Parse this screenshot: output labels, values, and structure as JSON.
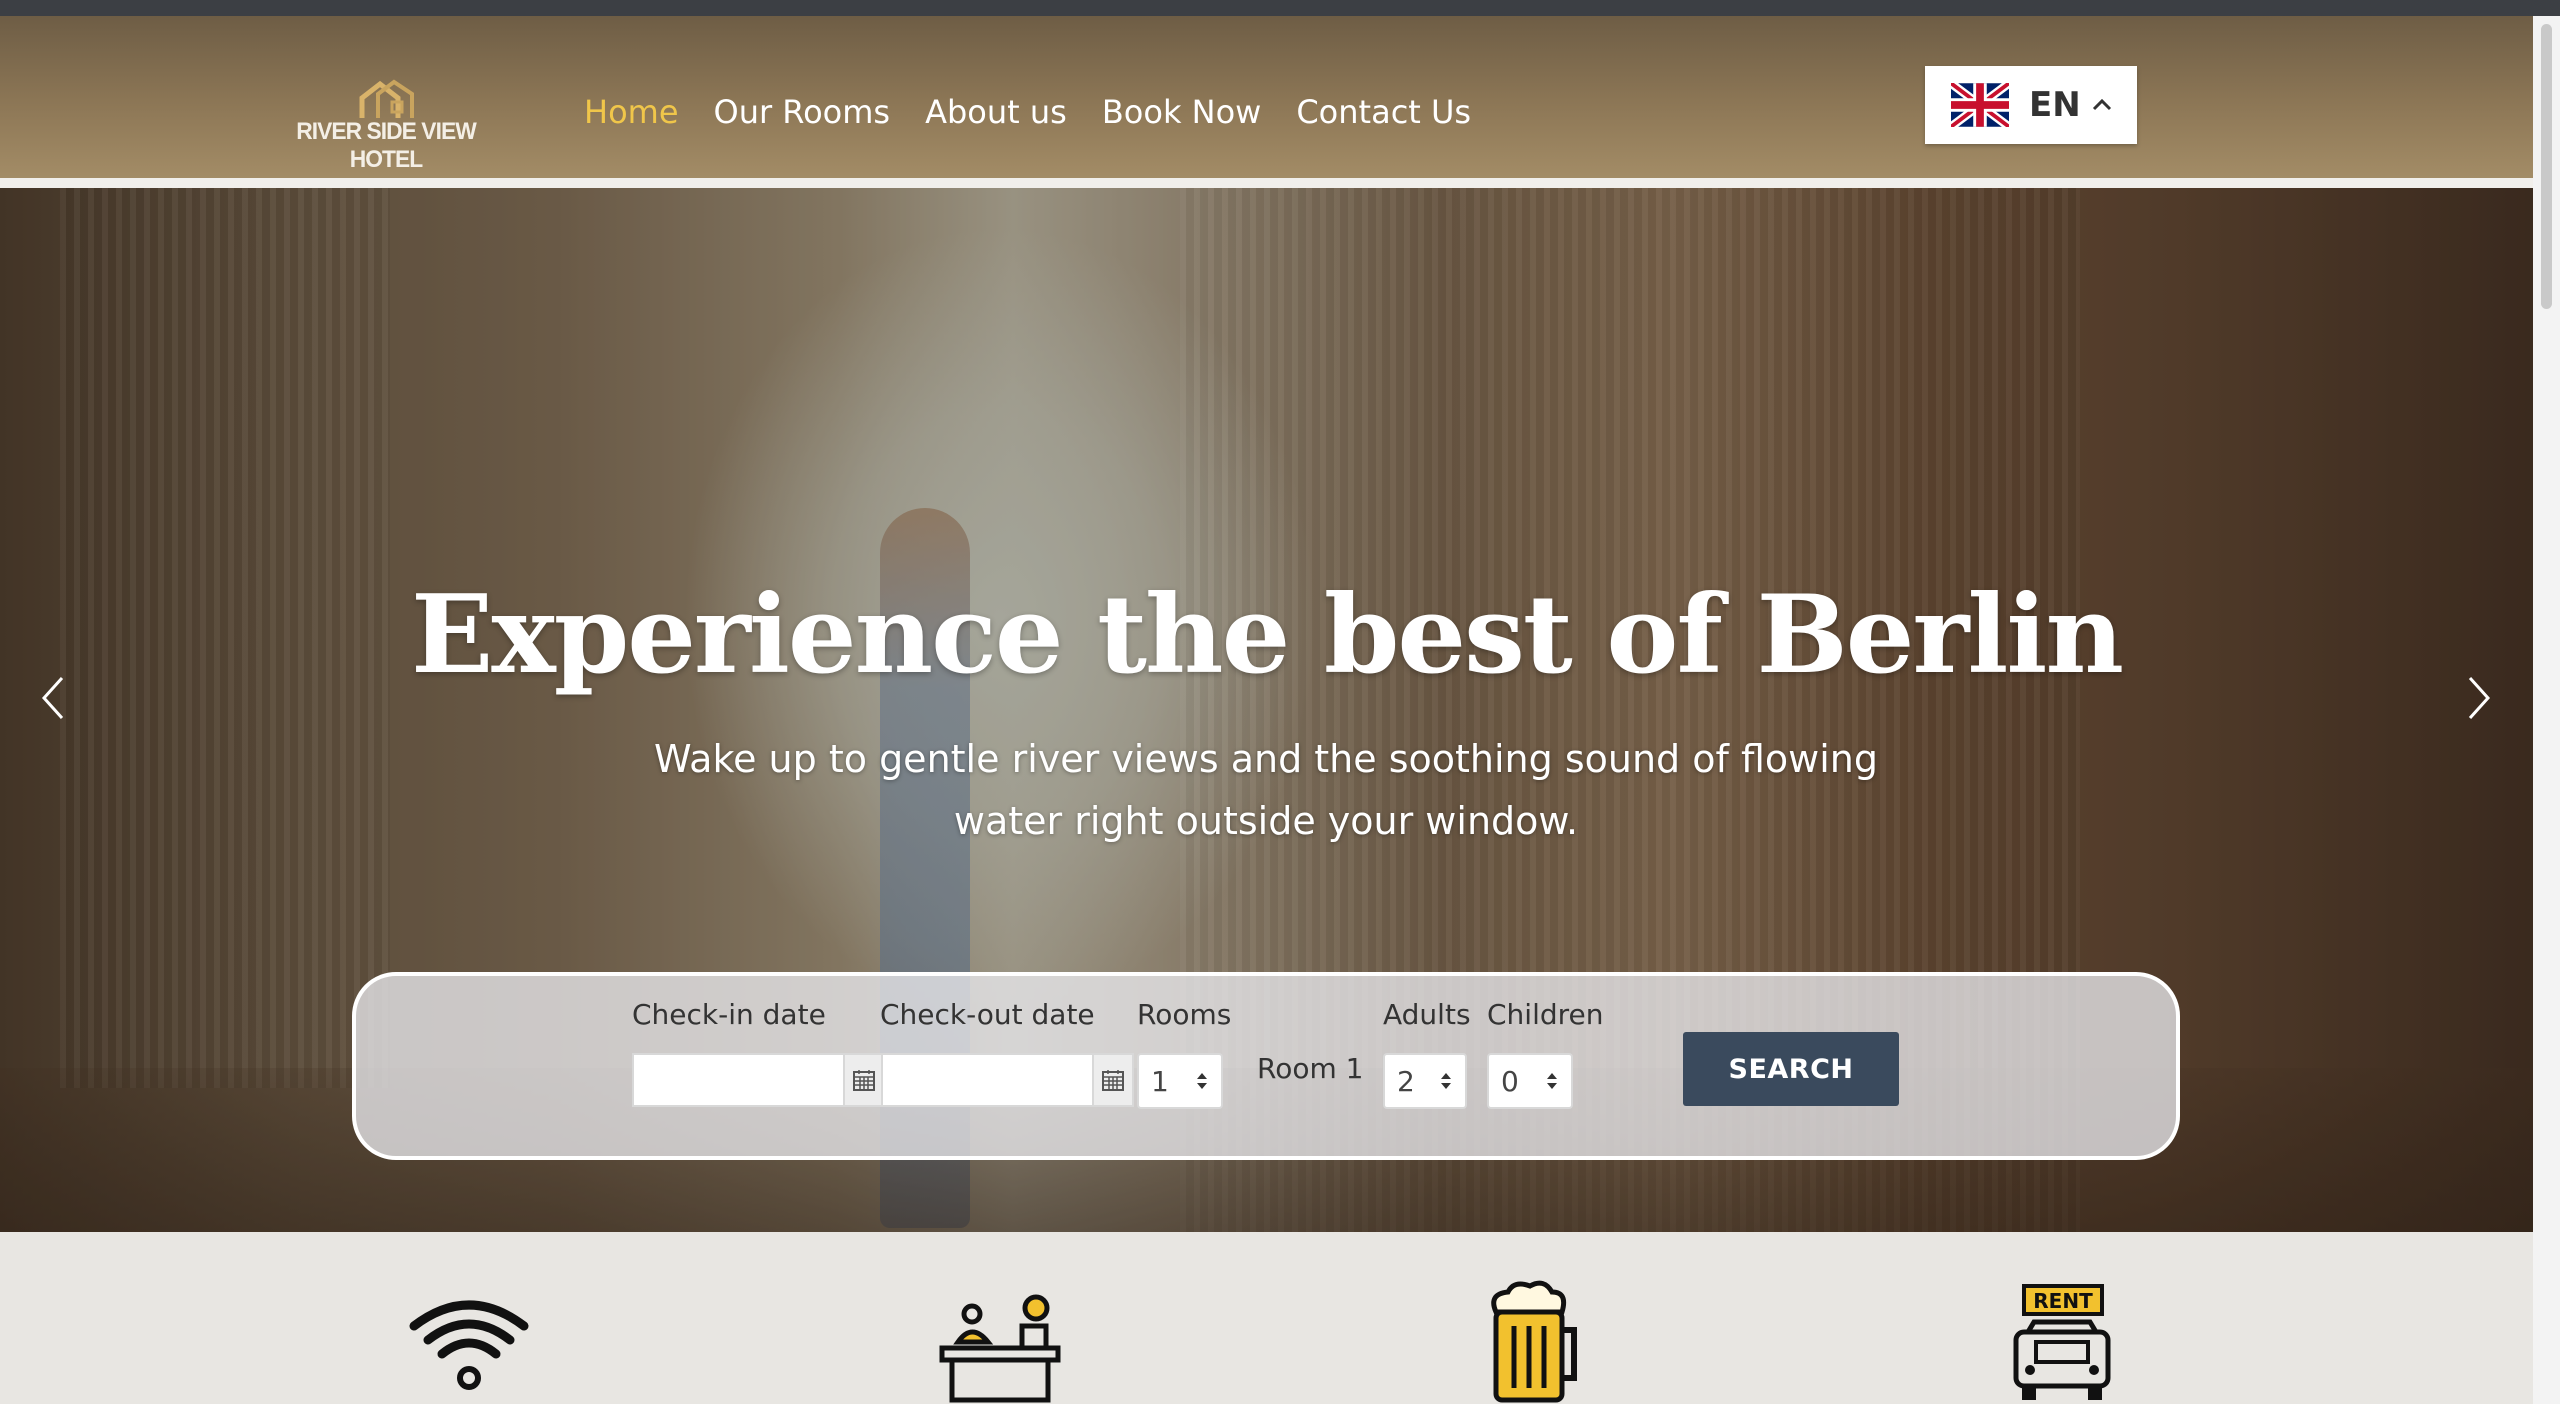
{
  "brand": {
    "logo_text": "RIVER SIDE VIEW HOTEL"
  },
  "nav": {
    "items": [
      {
        "label": "Home",
        "active": true
      },
      {
        "label": "Our Rooms",
        "active": false
      },
      {
        "label": "About us",
        "active": false
      },
      {
        "label": "Book Now",
        "active": false
      },
      {
        "label": "Contact Us",
        "active": false
      }
    ]
  },
  "language": {
    "code": "EN",
    "flag_icon": "uk-flag-icon",
    "chevron_icon": "chevron-up-icon"
  },
  "hero": {
    "title": "Experience the best of Berlin",
    "subtitle_line1": "Wake up to gentle river views and the soothing sound of flowing",
    "subtitle_line2": "water right outside your window."
  },
  "booking": {
    "checkin_label": "Check-in date",
    "checkout_label": "Check-out date",
    "checkin_value": "",
    "checkout_value": "",
    "rooms_label": "Rooms",
    "rooms_value": "1",
    "room_name": "Room 1",
    "adults_label": "Adults",
    "adults_value": "2",
    "children_label": "Children",
    "children_value": "0",
    "search_label": "SEARCH"
  },
  "amenities": [
    {
      "icon": "wifi-icon"
    },
    {
      "icon": "reception-desk-icon"
    },
    {
      "icon": "beer-mug-icon"
    },
    {
      "icon": "car-rental-icon",
      "badge": "RENT"
    }
  ],
  "colors": {
    "accent": "#f0c64a",
    "header": "#8d7756",
    "button": "#3a4a5d",
    "amenity_yellow": "#f2c12e"
  }
}
